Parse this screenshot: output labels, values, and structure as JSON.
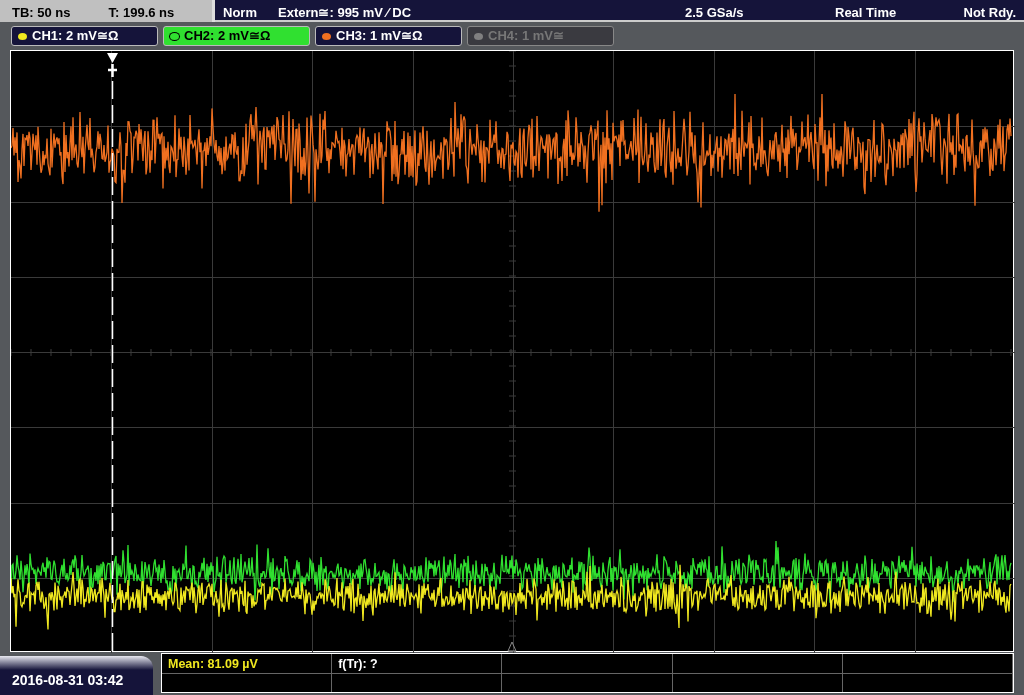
{
  "status_bar": {
    "timebase": "TB: 50 ns",
    "trigger_time": "T: 199.6 ns",
    "mode": "Norm",
    "trigger_source": "Extern≅: 995 mV ⁄ DC",
    "sample_rate": "2.5 GSa/s",
    "acquisition": "Real Time",
    "state": "Not Rdy."
  },
  "channels": [
    {
      "label": "CH1: 2 mV≅Ω",
      "color": "#f0e820",
      "selected": false,
      "enabled": true
    },
    {
      "label": "CH2: 2 mV≅Ω",
      "color": "#30e030",
      "selected": true,
      "enabled": true
    },
    {
      "label": "CH3: 1 mV≅Ω",
      "color": "#f07020",
      "selected": false,
      "enabled": true
    },
    {
      "label": "CH4: 1 mV≅",
      "color": "#808080",
      "selected": false,
      "enabled": false
    }
  ],
  "timestamp": "2016-08-31 03:42",
  "measurements": [
    {
      "text": "Mean: 81.09 µV",
      "color": "#f0e820"
    },
    {
      "text": "f(Tr): ?",
      "color": "#ffffff"
    }
  ]
}
